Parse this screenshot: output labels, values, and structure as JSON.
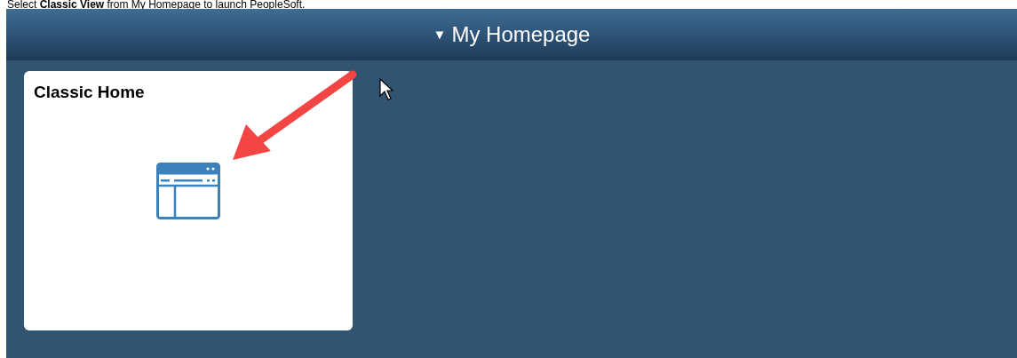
{
  "instruction": "Select **Classic View** from My Homepage to launch PeopleSoft.",
  "header": {
    "title": "My Homepage",
    "menu_symbol": "▼"
  },
  "tiles": [
    {
      "title": "Classic Home"
    }
  ]
}
